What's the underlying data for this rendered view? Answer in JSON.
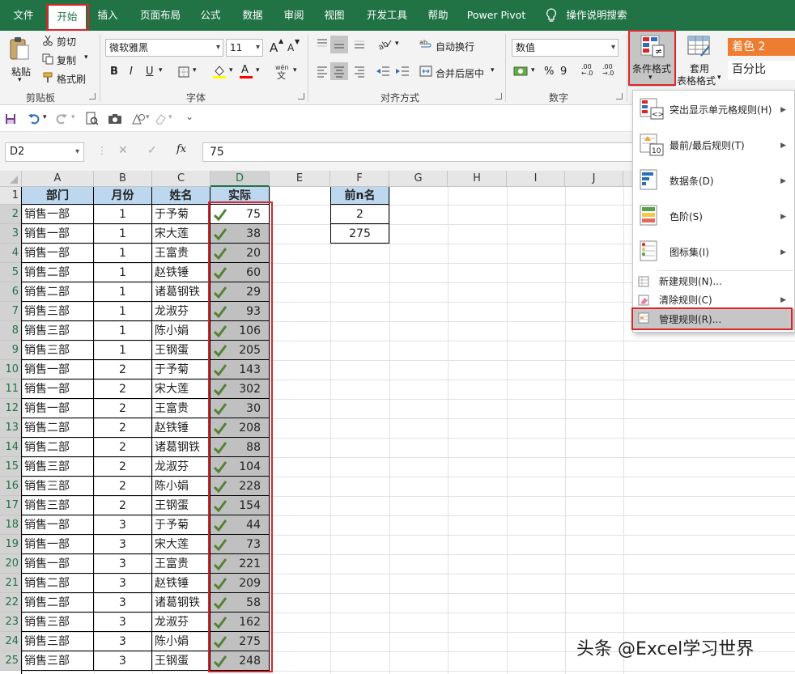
{
  "ribbon_tabs": [
    "文件",
    "开始",
    "插入",
    "页面布局",
    "公式",
    "数据",
    "审阅",
    "视图",
    "开发工具",
    "帮助",
    "Power Pivot",
    "操作说明搜索"
  ],
  "clipboard": {
    "paste": "粘贴",
    "cut": "剪切",
    "copy": "复制",
    "format_painter": "格式刷",
    "label": "剪贴板"
  },
  "font": {
    "family": "微软雅黑",
    "size": "11",
    "grow": "A",
    "shrink": "A",
    "bold": "B",
    "italic": "I",
    "underline": "U",
    "font_color_glyph": "A",
    "label": "字体"
  },
  "alignment": {
    "wrap": "自动换行",
    "merge": "合并后居中",
    "label": "对齐方式"
  },
  "number": {
    "format": "数值",
    "percent": "%",
    "comma": "9",
    "inc": ".00 ←.0",
    "dec": ".00 →.0",
    "label": "数字"
  },
  "styles": {
    "conditional_format": "条件格式",
    "table_format_line1": "套用",
    "table_format_line2": "表格格式",
    "style1": "着色 2",
    "style2": "百分比"
  },
  "quick_access": [
    "save",
    "undo",
    "redo",
    "print-preview",
    "camera",
    "shapes",
    "customize"
  ],
  "formula_bar": {
    "name_box": "D2",
    "fx": "fx",
    "formula": "75"
  },
  "columns": [
    "A",
    "B",
    "C",
    "D",
    "E",
    "F",
    "G",
    "H",
    "I",
    "J"
  ],
  "rows": [
    "1",
    "2",
    "3",
    "4",
    "5",
    "6",
    "7",
    "8",
    "9",
    "10",
    "11",
    "12",
    "13",
    "14",
    "15",
    "16",
    "17",
    "18",
    "19",
    "20",
    "21",
    "22",
    "23",
    "24",
    "25"
  ],
  "table": {
    "headers": [
      "部门",
      "月份",
      "姓名",
      "实际"
    ],
    "rows": [
      [
        "销售一部",
        "1",
        "于予菊",
        "75"
      ],
      [
        "销售一部",
        "1",
        "宋大莲",
        "38"
      ],
      [
        "销售一部",
        "1",
        "王富贵",
        "20"
      ],
      [
        "销售二部",
        "1",
        "赵铁锤",
        "60"
      ],
      [
        "销售二部",
        "1",
        "诸葛钢铁",
        "29"
      ],
      [
        "销售三部",
        "1",
        "龙淑芬",
        "93"
      ],
      [
        "销售三部",
        "1",
        "陈小娟",
        "106"
      ],
      [
        "销售三部",
        "1",
        "王钢蛋",
        "205"
      ],
      [
        "销售一部",
        "2",
        "于予菊",
        "143"
      ],
      [
        "销售一部",
        "2",
        "宋大莲",
        "302"
      ],
      [
        "销售一部",
        "2",
        "王富贵",
        "30"
      ],
      [
        "销售二部",
        "2",
        "赵铁锤",
        "208"
      ],
      [
        "销售二部",
        "2",
        "诸葛钢铁",
        "88"
      ],
      [
        "销售三部",
        "2",
        "龙淑芬",
        "104"
      ],
      [
        "销售三部",
        "2",
        "陈小娟",
        "228"
      ],
      [
        "销售三部",
        "2",
        "王钢蛋",
        "154"
      ],
      [
        "销售一部",
        "3",
        "于予菊",
        "44"
      ],
      [
        "销售一部",
        "3",
        "宋大莲",
        "73"
      ],
      [
        "销售一部",
        "3",
        "王富贵",
        "221"
      ],
      [
        "销售二部",
        "3",
        "赵铁锤",
        "209"
      ],
      [
        "销售二部",
        "3",
        "诸葛钢铁",
        "58"
      ],
      [
        "销售三部",
        "3",
        "龙淑芬",
        "162"
      ],
      [
        "销售三部",
        "3",
        "陈小娟",
        "275"
      ],
      [
        "销售三部",
        "3",
        "王钢蛋",
        "248"
      ]
    ]
  },
  "side_table": {
    "header": "前n名",
    "values": [
      "2",
      "275"
    ]
  },
  "cf_menu": [
    {
      "label": "突出显示单元格规则(H)",
      "icon": "highlight-rules-icon",
      "submenu": true
    },
    {
      "label": "最前/最后规则(T)",
      "icon": "top-bottom-rules-icon",
      "submenu": true
    },
    {
      "label": "数据条(D)",
      "icon": "data-bars-icon",
      "submenu": true
    },
    {
      "label": "色阶(S)",
      "icon": "color-scales-icon",
      "submenu": true
    },
    {
      "label": "图标集(I)",
      "icon": "icon-sets-icon",
      "submenu": true
    },
    {
      "label": "新建规则(N)...",
      "icon": "new-rule-icon",
      "submenu": false
    },
    {
      "label": "清除规则(C)",
      "icon": "clear-rules-icon",
      "submenu": true
    },
    {
      "label": "管理规则(R)...",
      "icon": "manage-rules-icon",
      "submenu": false
    }
  ],
  "watermark": "头条 @Excel学习世界",
  "colors": {
    "excel_green": "#217346",
    "header_fill": "#bdd7ee",
    "selection_fill": "#c0c0c0",
    "check_green": "#548235",
    "highlight_red": "#d9262b"
  }
}
